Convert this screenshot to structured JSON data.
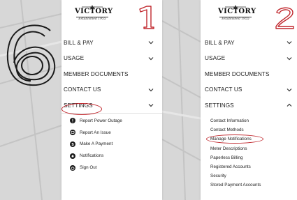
{
  "panels": [
    {
      "step": "1",
      "logo": {
        "word": "VICTORY",
        "script": "Established 1955"
      },
      "menu": [
        {
          "label": "BILL & PAY",
          "chevron": "chevron-down"
        },
        {
          "label": "USAGE",
          "chevron": "chevron-down"
        },
        {
          "label": "MEMBER DOCUMENTS",
          "chevron": ""
        },
        {
          "label": "CONTACT US",
          "chevron": "chevron-down"
        },
        {
          "label": "SETTINGS",
          "chevron": "chevron-down",
          "highlighted": true
        }
      ],
      "sub_items": [
        {
          "label": "Report Power Outage",
          "icon": "alert-icon"
        },
        {
          "label": "Report An Issue",
          "icon": "message-icon"
        },
        {
          "label": "Make A Payment",
          "icon": "dollar-icon"
        },
        {
          "label": "Notifications",
          "icon": "bell-icon"
        },
        {
          "label": "Sign Out",
          "icon": "power-icon"
        }
      ]
    },
    {
      "step": "2",
      "logo": {
        "word": "VICTORY",
        "script": "Established 1955"
      },
      "menu": [
        {
          "label": "BILL & PAY",
          "chevron": "chevron-down"
        },
        {
          "label": "USAGE",
          "chevron": "chevron-down"
        },
        {
          "label": "MEMBER DOCUMENTS",
          "chevron": ""
        },
        {
          "label": "CONTACT US",
          "chevron": "chevron-down"
        },
        {
          "label": "SETTINGS",
          "chevron": "chevron-up"
        }
      ],
      "sub_items": [
        {
          "label": "Contact Information"
        },
        {
          "label": "Contact Methods"
        },
        {
          "label": "Manage Notifications",
          "highlighted": true
        },
        {
          "label": "Meter Descriptions"
        },
        {
          "label": "Paperless Billing"
        },
        {
          "label": "Registered Accounts"
        },
        {
          "label": "Security"
        },
        {
          "label": "Stored Payment Accounts"
        }
      ]
    }
  ],
  "big_step": "6",
  "colors": {
    "highlight": "#c0272d",
    "background": "#d7d7d7",
    "panel": "#ffffff",
    "text": "#222222"
  }
}
